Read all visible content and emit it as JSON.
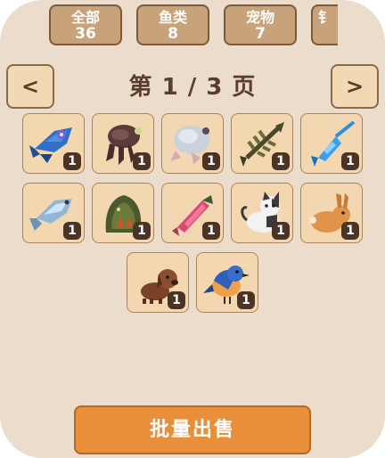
{
  "tabs": [
    {
      "label": "全部",
      "count": "36"
    },
    {
      "label": "鱼类",
      "count": "8"
    },
    {
      "label": "宠物",
      "count": "7"
    },
    {
      "label": "钅",
      "count": ""
    }
  ],
  "pager": {
    "prev_label": "<",
    "next_label": ">",
    "page_text": "第 1 / 3 页"
  },
  "items": [
    {
      "icon": "blue-fish-icon",
      "qty": "1"
    },
    {
      "icon": "squid-icon",
      "qty": "1"
    },
    {
      "icon": "pufferfish-icon",
      "qty": "1"
    },
    {
      "icon": "fish-skeleton-icon",
      "qty": "1"
    },
    {
      "icon": "blue-swordfish-icon",
      "qty": "1"
    },
    {
      "icon": "silver-fish-icon",
      "qty": "1"
    },
    {
      "icon": "seaweed-creature-icon",
      "qty": "1"
    },
    {
      "icon": "pink-eel-icon",
      "qty": "1"
    },
    {
      "icon": "calico-cat-icon",
      "qty": "1"
    },
    {
      "icon": "rabbit-icon",
      "qty": "1"
    },
    {
      "icon": "brown-puppy-icon",
      "qty": "1"
    },
    {
      "icon": "bluebird-icon",
      "qty": "1"
    }
  ],
  "sell_button_label": "批量出售"
}
